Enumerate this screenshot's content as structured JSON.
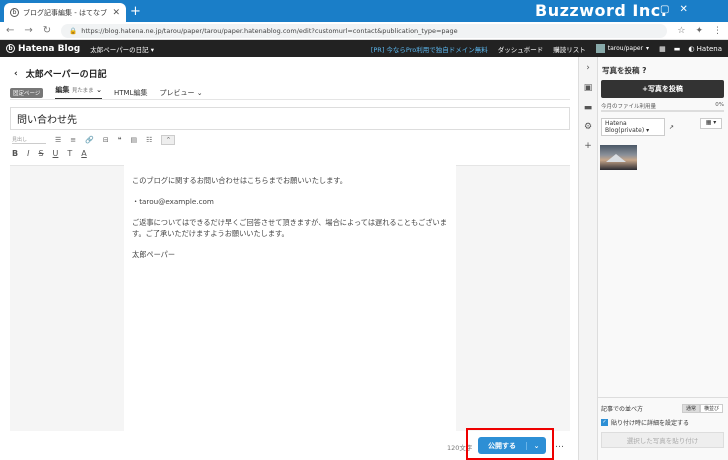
{
  "browser": {
    "tab_title": "ブログ記事編集 - はてなブログ",
    "url": "https://blog.hatena.ne.jp/tarou/paper/tarou/paper.hatenablog.com/edit?customurl=contact&publication_type=page",
    "new_tab": "+",
    "brand": "Buzzword Inc.",
    "window_controls": [
      "—",
      "▢",
      "✕"
    ]
  },
  "header": {
    "logo": "Hatena Blog",
    "blog_name": "太郎ペーパーの日記",
    "promo": "[PR] 今ならPro利用で独自ドメイン無料",
    "dashboard": "ダッシュボード",
    "reading_list": "購読リスト",
    "user": "tarou/paper",
    "hatena": "Hatena"
  },
  "editor": {
    "blog_title": "太郎ペーパーの日記",
    "fixed_page_badge": "固定ページ",
    "tabs": [
      {
        "label": "編集",
        "sub": "見たまま"
      },
      {
        "label": "HTML編集"
      },
      {
        "label": "プレビュー"
      }
    ],
    "title_value": "問い合わせ先",
    "heading_select": "見出し",
    "body": [
      "このブログに関するお問い合わせはこちらまでお願いいたします。",
      "",
      "・tarou@example.com",
      "",
      "ご返事についてはできるだけ早くご回答させて頂きますが、場合によっては遅れることもございます。ご了承いただけますようお願いいたします。",
      "",
      "太郎ペーパー"
    ],
    "char_count": "120文字",
    "publish_label": "公開する",
    "more": "…"
  },
  "panel": {
    "title": "写真を投稿",
    "upload_button": "写真を投稿",
    "usage_label": "今月のファイル利用量",
    "usage_percent": "0%",
    "usage_fraction": 0,
    "album": "Hatena Blog(private)",
    "sort_label": "記事での並べ方",
    "sort_options": [
      "通常",
      "横並び"
    ],
    "detail_label": "貼り付け時に詳細を設定する",
    "paste_button": "選択した写真を貼り付け"
  },
  "colors": {
    "chrome_blue": "#1a7ec8",
    "header_dark": "#222222",
    "publish_blue": "#2d8fd5",
    "highlight_red": "#ee0000"
  }
}
